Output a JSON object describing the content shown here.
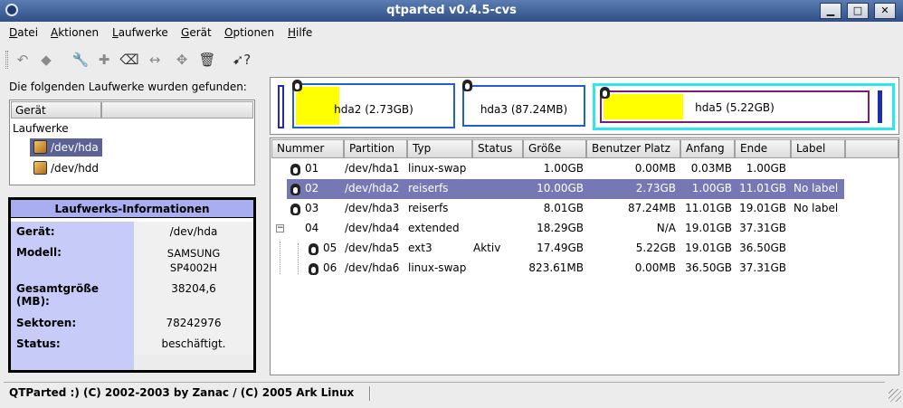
{
  "window": {
    "title": "qtparted v0.4.5-cvs"
  },
  "menu": [
    "Datei",
    "Aktionen",
    "Laufwerke",
    "Gerät",
    "Optionen",
    "Hilfe"
  ],
  "left": {
    "found_label": "Die folgenden Laufwerke wurden gefunden:",
    "tree_header": "Gerät",
    "tree_root": "Laufwerke",
    "devices": [
      "/dev/hda",
      "/dev/hdd"
    ]
  },
  "info": {
    "title": "Laufwerks-Informationen",
    "rows": [
      {
        "key": "Gerät:",
        "value": "/dev/hda"
      },
      {
        "key": "Modell:",
        "value": "SAMSUNG SP4002H"
      },
      {
        "key": "Gesamtgröße (MB):",
        "value": "38204,6"
      },
      {
        "key": "Sektoren:",
        "value": "78242976"
      },
      {
        "key": "Status:",
        "value": "beschäftigt."
      }
    ]
  },
  "map": {
    "partitions": [
      {
        "label": "hda2 (2.73GB)",
        "used_fraction": 0.27
      },
      {
        "label": "hda3 (87.24MB)",
        "used_fraction": 0.0
      },
      {
        "label": "hda5 (5.22GB)",
        "used_fraction": 0.3
      }
    ]
  },
  "table": {
    "columns": [
      "Nummer",
      "Partition",
      "Typ",
      "Status",
      "Größe",
      "Benutzer Platz",
      "Anfang",
      "Ende",
      "Label"
    ],
    "rows": [
      {
        "num": "01",
        "part": "/dev/hda1",
        "type": "linux-swap",
        "status": "",
        "size": "1.00GB",
        "used": "0.00MB",
        "start": "0.03MB",
        "end": "1.00GB",
        "label": ""
      },
      {
        "num": "02",
        "part": "/dev/hda2",
        "type": "reiserfs",
        "status": "",
        "size": "10.00GB",
        "used": "2.73GB",
        "start": "1.00GB",
        "end": "11.01GB",
        "label": "No label"
      },
      {
        "num": "03",
        "part": "/dev/hda3",
        "type": "reiserfs",
        "status": "",
        "size": "8.01GB",
        "used": "87.24MB",
        "start": "11.01GB",
        "end": "19.01GB",
        "label": "No label"
      },
      {
        "num": "04",
        "part": "/dev/hda4",
        "type": "extended",
        "status": "",
        "size": "18.29GB",
        "used": "N/A",
        "start": "19.01GB",
        "end": "37.31GB",
        "label": ""
      },
      {
        "num": "05",
        "part": "/dev/hda5",
        "type": "ext3",
        "status": "Aktiv",
        "size": "17.49GB",
        "used": "5.22GB",
        "start": "19.01GB",
        "end": "36.50GB",
        "label": ""
      },
      {
        "num": "06",
        "part": "/dev/hda6",
        "type": "linux-swap",
        "status": "",
        "size": "823.61MB",
        "used": "0.00MB",
        "start": "36.50GB",
        "end": "37.31GB",
        "label": ""
      }
    ]
  },
  "status": {
    "text": "QTParted :)  (C) 2002-2003 by Zanac / (C) 2005 Ark Linux"
  },
  "colors": {
    "selection": "#7678b6",
    "info_header": "#a9aef0",
    "map_used": "#ffff00",
    "extended_border": "#2de6f0",
    "logical_border": "#7a1c70"
  }
}
